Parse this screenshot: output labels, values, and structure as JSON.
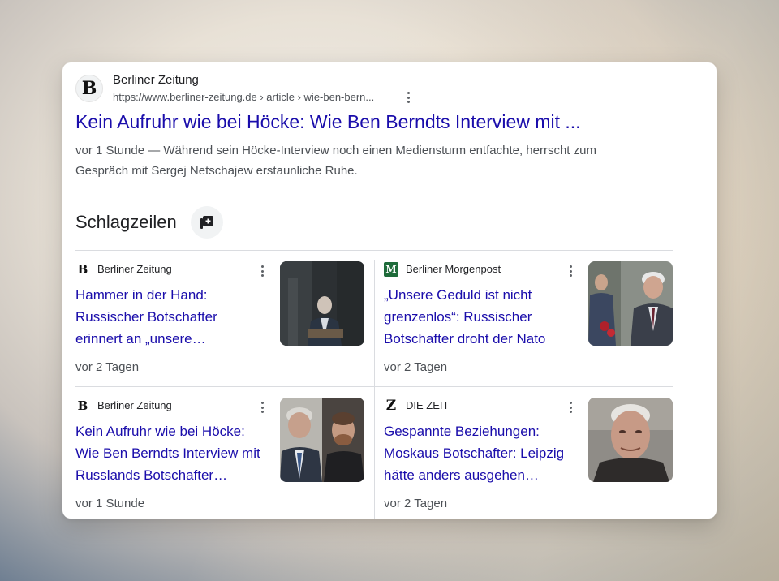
{
  "result": {
    "site_name": "Berliner Zeitung",
    "site_logo_glyph": "B",
    "url": "https://www.berliner-zeitung.de › article › wie-ben-bern...",
    "title": "Kein Aufruhr wie bei Höcke: Wie Ben Berndts Interview mit ...",
    "snippet": "vor 1 Stunde — Während sein Höcke-Interview noch einen Mediensturm entfachte, herrscht zum Gespräch mit Sergej Netschajew erstaunliche Ruhe."
  },
  "headlines": {
    "title": "Schlagzeilen",
    "stories": [
      {
        "source": "Berliner Zeitung",
        "source_glyph": "B",
        "headline": "Hammer in der Hand: Russischer Botschafter erinnert an „unsere…",
        "time": "vor 2 Tagen"
      },
      {
        "source": "Berliner Morgenpost",
        "source_glyph": "M",
        "headline": "„Unsere Geduld ist nicht grenzenlos“: Russischer Botschafter droht der Nato",
        "time": "vor 2 Tagen"
      },
      {
        "source": "Berliner Zeitung",
        "source_glyph": "B",
        "headline": "Kein Aufruhr wie bei Höcke: Wie Ben Berndts Interview mit Russlands Botschafter…",
        "time": "vor 1 Stunde"
      },
      {
        "source": "DIE ZEIT",
        "source_glyph": "Z",
        "headline": "Gespannte Beziehungen: Moskaus Botschafter: Leipzig hätte anders ausgehen…",
        "time": "vor 2 Tagen"
      }
    ]
  },
  "colors": {
    "link": "#1a0dab",
    "text": "#202124",
    "muted": "#4d5156",
    "morgenpost_green": "#1e6b3a"
  }
}
